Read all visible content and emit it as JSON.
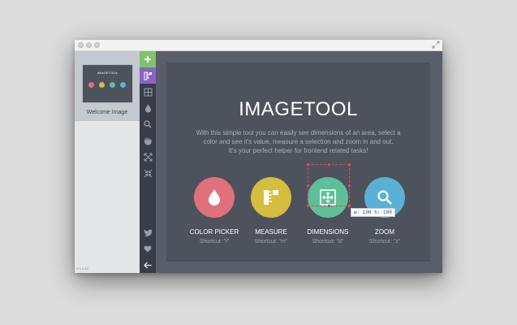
{
  "window": {
    "expand_icon": "expand-icon"
  },
  "sidebar": {
    "thumbnail_title": "IMAGETOOL",
    "item_label": "Welcome Image",
    "version": "V 1.3.10"
  },
  "toolbar": {
    "tools": [
      {
        "name": "add",
        "icon": "plus-icon",
        "color": "#7fc36b"
      },
      {
        "name": "measure",
        "icon": "ruler-icon",
        "color": "#8d63c4"
      },
      {
        "name": "dimensions",
        "icon": "dimensions-icon"
      },
      {
        "name": "color-picker",
        "icon": "droplet-icon"
      },
      {
        "name": "zoom",
        "icon": "magnifier-icon"
      },
      {
        "name": "hand",
        "icon": "hand-icon"
      },
      {
        "name": "expand",
        "icon": "expand-arrows-icon"
      },
      {
        "name": "collapse",
        "icon": "collapse-arrows-icon"
      },
      {
        "name": "twitter",
        "icon": "twitter-icon"
      },
      {
        "name": "favorite",
        "icon": "heart-icon"
      },
      {
        "name": "back",
        "icon": "arrow-left-icon"
      }
    ]
  },
  "main": {
    "title": "IMAGETOOL",
    "description_lines": [
      "With this simple tool you can easily see dimensions of an area, select a",
      "color and see it's value, measure a selection and zoom in and out.",
      "It's your perfect helper for frontend related tasks!"
    ],
    "features": [
      {
        "label": "COLOR PICKER",
        "shortcut": "Shortcut: \"i\"",
        "color": "#e0717c",
        "icon": "droplet-icon"
      },
      {
        "label": "MEASURE",
        "shortcut": "Shortcut: \"m\"",
        "color": "#d4bd3f",
        "icon": "ruler-icon"
      },
      {
        "label": "DIMENSIONS",
        "shortcut": "Shortcut: \"d\"",
        "color": "#5fbf9b",
        "icon": "dimensions-icon"
      },
      {
        "label": "ZOOM",
        "shortcut": "Shortcut: \"z\"",
        "color": "#5bb0d6",
        "icon": "magnifier-icon"
      }
    ],
    "selection_label": "w: 100 h: 100"
  }
}
